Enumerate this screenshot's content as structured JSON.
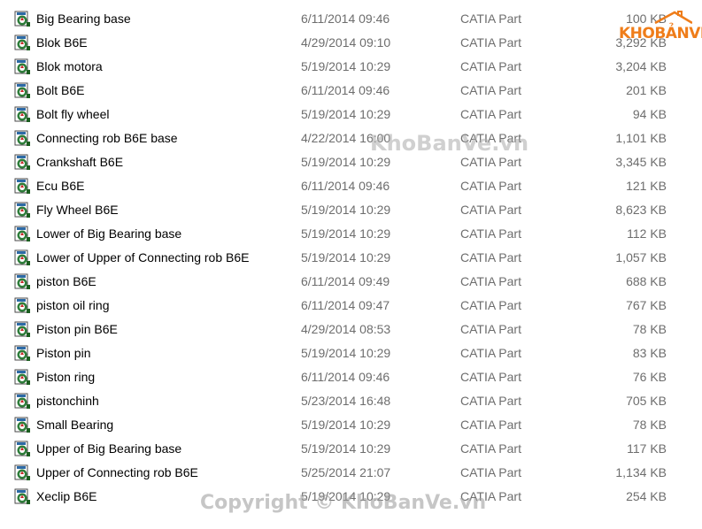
{
  "files": [
    {
      "name": "Big Bearing base",
      "date": "6/11/2014 09:46",
      "type": "CATIA Part",
      "size": "100 KB",
      "icon": "catia-part-icon"
    },
    {
      "name": "Blok B6E",
      "date": "4/29/2014 09:10",
      "type": "CATIA Part",
      "size": "3,292 KB",
      "icon": "catia-part-icon"
    },
    {
      "name": "Blok motora",
      "date": "5/19/2014 10:29",
      "type": "CATIA Part",
      "size": "3,204 KB",
      "icon": "catia-part-icon"
    },
    {
      "name": "Bolt B6E",
      "date": "6/11/2014 09:46",
      "type": "CATIA Part",
      "size": "201 KB",
      "icon": "catia-part-icon"
    },
    {
      "name": "Bolt fly wheel",
      "date": "5/19/2014 10:29",
      "type": "CATIA Part",
      "size": "94 KB",
      "icon": "catia-part-icon"
    },
    {
      "name": "Connecting rob B6E base",
      "date": "4/22/2014 16:00",
      "type": "CATIA Part",
      "size": "1,101 KB",
      "icon": "catia-part-icon"
    },
    {
      "name": "Crankshaft B6E",
      "date": "5/19/2014 10:29",
      "type": "CATIA Part",
      "size": "3,345 KB",
      "icon": "catia-part-icon"
    },
    {
      "name": "Ecu B6E",
      "date": "6/11/2014 09:46",
      "type": "CATIA Part",
      "size": "121 KB",
      "icon": "catia-part-icon"
    },
    {
      "name": "Fly Wheel B6E",
      "date": "5/19/2014 10:29",
      "type": "CATIA Part",
      "size": "8,623 KB",
      "icon": "catia-part-icon"
    },
    {
      "name": "Lower of Big Bearing base",
      "date": "5/19/2014 10:29",
      "type": "CATIA Part",
      "size": "112 KB",
      "icon": "catia-part-icon"
    },
    {
      "name": "Lower of Upper of Connecting rob B6E",
      "date": "5/19/2014 10:29",
      "type": "CATIA Part",
      "size": "1,057 KB",
      "icon": "catia-part-icon"
    },
    {
      "name": "piston B6E",
      "date": "6/11/2014 09:49",
      "type": "CATIA Part",
      "size": "688 KB",
      "icon": "catia-part-icon"
    },
    {
      "name": "piston oil ring",
      "date": "6/11/2014 09:47",
      "type": "CATIA Part",
      "size": "767 KB",
      "icon": "catia-part-icon"
    },
    {
      "name": "Piston pin B6E",
      "date": "4/29/2014 08:53",
      "type": "CATIA Part",
      "size": "78 KB",
      "icon": "catia-part-icon"
    },
    {
      "name": "Piston pin",
      "date": "5/19/2014 10:29",
      "type": "CATIA Part",
      "size": "83 KB",
      "icon": "catia-part-icon"
    },
    {
      "name": "Piston ring",
      "date": "6/11/2014 09:46",
      "type": "CATIA Part",
      "size": "76 KB",
      "icon": "catia-part-icon"
    },
    {
      "name": "pistonchinh",
      "date": "5/23/2014 16:48",
      "type": "CATIA Part",
      "size": "705 KB",
      "icon": "catia-part-icon"
    },
    {
      "name": "Small Bearing",
      "date": "5/19/2014 10:29",
      "type": "CATIA Part",
      "size": "78 KB",
      "icon": "catia-part-icon"
    },
    {
      "name": "Upper of Big Bearing base",
      "date": "5/19/2014 10:29",
      "type": "CATIA Part",
      "size": "117 KB",
      "icon": "catia-part-icon"
    },
    {
      "name": "Upper of Connecting rob B6E",
      "date": "5/25/2014 21:07",
      "type": "CATIA Part",
      "size": "1,134 KB",
      "icon": "catia-part-icon"
    },
    {
      "name": "Xeclip B6E",
      "date": "5/19/2014 10:29",
      "type": "CATIA Part",
      "size": "254 KB",
      "icon": "catia-part-icon"
    }
  ],
  "watermark": {
    "logo_text": "KHOBẢNVẼ",
    "center_text": "KhoBanVe.vn",
    "bottom_text": "Copyright © KhoBanVe.vn"
  },
  "colors": {
    "detail_text": "#6d6d6d",
    "logo_orange": "#ef7d1a"
  }
}
